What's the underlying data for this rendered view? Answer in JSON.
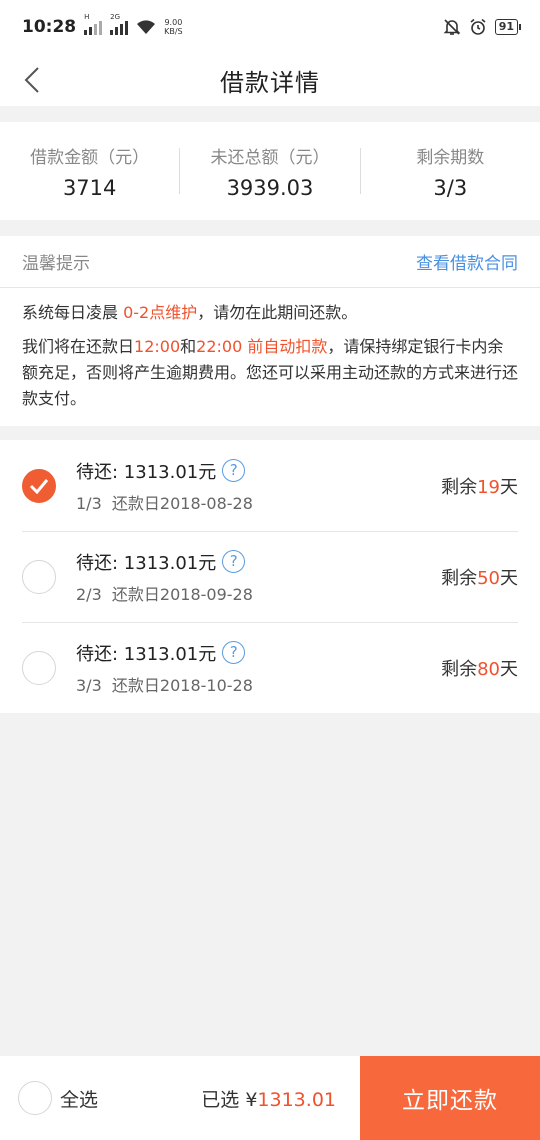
{
  "status_bar": {
    "time": "10:28",
    "net1": "H",
    "net2": "2G",
    "speed_value": "9.00",
    "speed_unit": "KB/S",
    "battery": "91"
  },
  "nav": {
    "title": "借款详情"
  },
  "summary": [
    {
      "label": "借款金额（元）",
      "value": "3714"
    },
    {
      "label": "未还总额（元）",
      "value": "3939.03"
    },
    {
      "label": "剩余期数",
      "value": "3/3"
    }
  ],
  "tips": {
    "title": "温馨提示",
    "link": "查看借款合同",
    "line1_a": "系统每日凌晨 ",
    "line1_b": "0-2点维护",
    "line1_c": "，请勿在此期间还款。",
    "line2_a": "我们将在还款日",
    "line2_b": "12:00",
    "line2_c": "和",
    "line2_d": "22:00 前自动扣款",
    "line2_e": "，请保持绑定银行卡内余额充足，否则将产生逾期费用。您还可以采用主动还款的方式来进行还款支付。"
  },
  "installments": [
    {
      "amount": "待还: 1313.01元",
      "period": "1/3",
      "date_label": "还款日2018-08-28",
      "days_prefix": "剩余",
      "days": "19",
      "days_suffix": "天",
      "checked": true
    },
    {
      "amount": "待还: 1313.01元",
      "period": "2/3",
      "date_label": "还款日2018-09-28",
      "days_prefix": "剩余",
      "days": "50",
      "days_suffix": "天",
      "checked": false
    },
    {
      "amount": "待还: 1313.01元",
      "period": "3/3",
      "date_label": "还款日2018-10-28",
      "days_prefix": "剩余",
      "days": "80",
      "days_suffix": "天",
      "checked": false
    }
  ],
  "bottom": {
    "select_all": "全选",
    "selected_label": "已选 ¥",
    "selected_amount": "1313.01",
    "pay_button": "立即还款"
  },
  "colors": {
    "accent": "#f05d32",
    "link": "#4a90e2",
    "button": "#f7683c"
  }
}
